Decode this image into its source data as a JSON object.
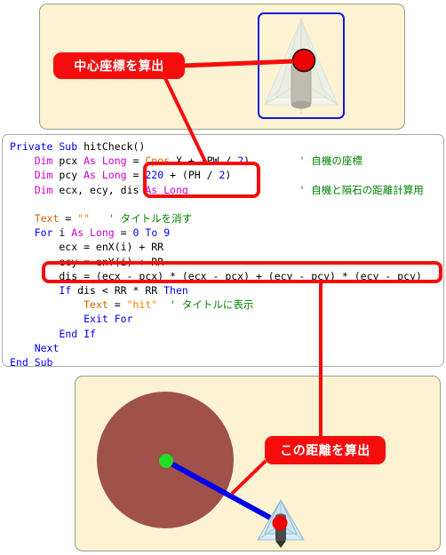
{
  "figure": {
    "type": "annotated-code-diagram",
    "language": "Visual Basic"
  },
  "panels": {
    "top": {
      "name": "center-coordinate-panel",
      "callout_label": "中心座標を算出",
      "ship": {
        "icon": "player-ship-icon",
        "marker": "center-point-marker",
        "marker_color": "#ee0000",
        "frame_color": "#1414e6",
        "body_color": "#b0aca0",
        "hull_color": "#eef2e6"
      }
    },
    "bottom": {
      "name": "distance-panel",
      "callout_label": "この距離を算出",
      "meteor": {
        "icon": "meteor-icon",
        "fill": "#a0514a",
        "center_marker": "meteor-center-marker",
        "center_color": "#22dd22"
      },
      "ship": {
        "icon": "player-ship-icon",
        "marker": "ship-center-marker",
        "marker_color": "#ee0000",
        "hull_color": "#cfe6f2",
        "body_color": "#4a4a4a"
      },
      "distance_line": {
        "name": "distance-line",
        "color": "#0000ee"
      }
    }
  },
  "code": {
    "panel_name": "code-listing",
    "background": "#ffffff",
    "lines": [
      "Private Sub hitCheck()",
      "    Dim pcx As Long = Cpos.X + (PW / 2)        ' 自機の座標",
      "    Dim pcy As Long = 220 + (PH / 2)",
      "    Dim ecx, ecy, dis As Long                  ' 自機と隕石の距離計算用",
      "",
      "    Text = \"\"   ' タイトルを消す",
      "    For i As Long = 0 To 9",
      "        ecx = enX(i) + RR",
      "        ecy = enY(i) + RR",
      "        dis = (ecx - pcx) * (ecx - pcx) + (ecy - pcy) * (ecy - pcy)",
      "        If dis < RR * RR Then",
      "            Text = \"hit\"  ' タイトルに表示",
      "            Exit For",
      "        End If",
      "    Next",
      "End Sub"
    ],
    "comments": [
      "' 自機の座標",
      "' 自機と隕石の距離計算用",
      "' タイトルを消す",
      "' タイトルに表示"
    ],
    "strings": [
      "\"\"",
      "\"hit\""
    ],
    "highlighted_regions": [
      {
        "name": "center-coordinate-highlight",
        "lines": [
          "Cpos.X + (PW / 2)",
          "220 + (PH / 2)"
        ]
      },
      {
        "name": "distance-formula-highlight",
        "lines": [
          "dis = (ecx - pcx) * (ecx - pcx) + (ecy - pcy) * (ecy - pcy)"
        ]
      }
    ],
    "syntax_colors": {
      "keyword": "#0000ff",
      "type": "#cc00cc",
      "string": "#ff8000",
      "comment": "#008000",
      "property": "#cc6600",
      "plain": "#000000"
    }
  },
  "annotation_color": "#f50d0d"
}
